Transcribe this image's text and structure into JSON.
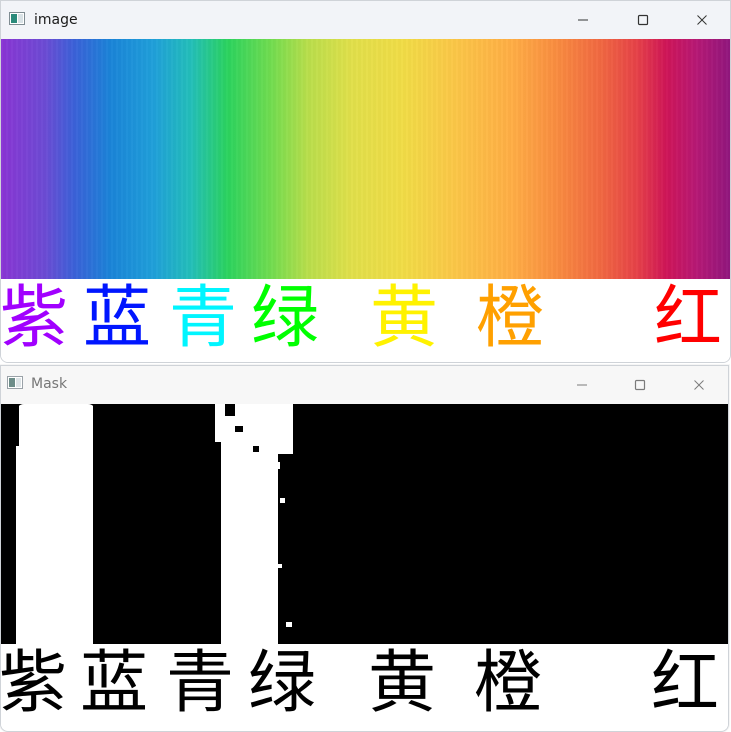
{
  "windows": {
    "image": {
      "title": "image",
      "characters": [
        {
          "text": "紫",
          "color": "#a100ff"
        },
        {
          "text": "蓝",
          "color": "#0016ff"
        },
        {
          "text": "青",
          "color": "#00f5ff"
        },
        {
          "text": "绿",
          "color": "#00ff00"
        },
        {
          "text": "黄",
          "color": "#fff200"
        },
        {
          "text": "橙",
          "color": "#ffa000"
        },
        {
          "text": "红",
          "color": "#ff0000"
        }
      ],
      "spectrum_colors": [
        "#8a35d4",
        "#3b61d8",
        "#1a84d8",
        "#23bfb9",
        "#2bd35e",
        "#b9de4b",
        "#f1dc46",
        "#ffad45",
        "#f16841",
        "#cf1557",
        "#8e167e"
      ]
    },
    "mask": {
      "title": "Mask",
      "characters": [
        {
          "text": "紫",
          "color": "#000000"
        },
        {
          "text": "蓝",
          "color": "#000000"
        },
        {
          "text": "青",
          "color": "#000000"
        },
        {
          "text": "绿",
          "color": "#000000"
        },
        {
          "text": "黄",
          "color": "#000000"
        },
        {
          "text": "橙",
          "color": "#000000"
        },
        {
          "text": "红",
          "color": "#000000"
        }
      ]
    }
  },
  "window_controls": {
    "minimize_icon": "minimize-icon",
    "maximize_icon": "maximize-icon",
    "close_icon": "close-icon"
  }
}
